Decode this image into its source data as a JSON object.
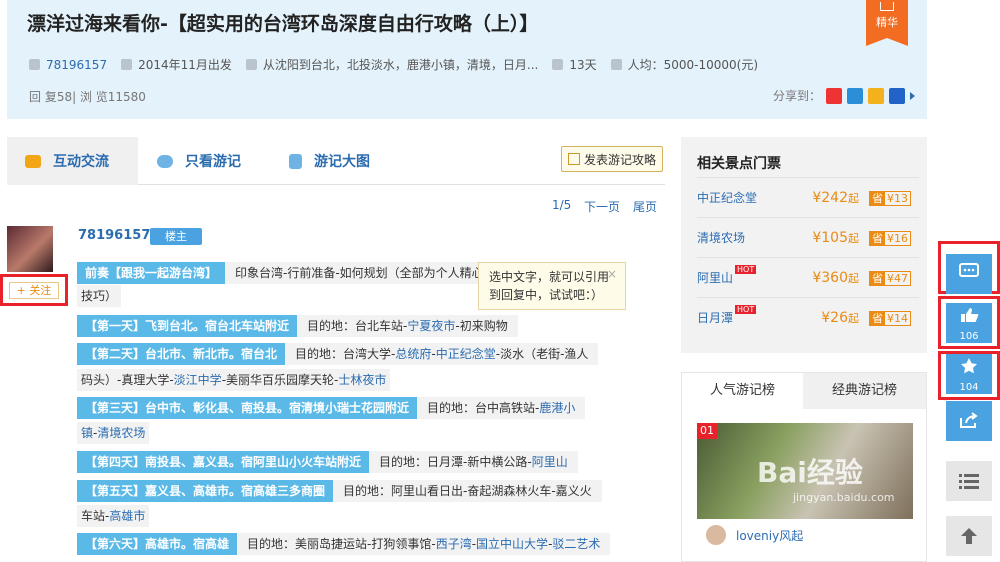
{
  "header": {
    "title": "漂洋过海来看你-【超实用的台湾环岛深度自由行攻略（上）】",
    "badge": "精华",
    "author": "78196157",
    "depart": "2014年11月出发",
    "route": "从沈阳到台北，北投淡水，鹿港小镇，清境，日月...",
    "days": "13天",
    "budget": "人均：5000-10000(元)",
    "stats": "回 复58| 浏 览11580",
    "share_label": "分享到："
  },
  "tabs": [
    {
      "label": "互动交流"
    },
    {
      "label": "只看游记"
    },
    {
      "label": "游记大图"
    }
  ],
  "post_button": "发表游记攻略",
  "pager": {
    "page": "1/5",
    "next": "下一页",
    "last": "尾页"
  },
  "post": {
    "follow": "+ 关注",
    "username": "78196157",
    "role": "楼主"
  },
  "tip": {
    "text": "选中文字，就可以引用到回复中，试试吧：）",
    "close": "×"
  },
  "toc": [
    {
      "tag": "前奏【跟我一起游台湾】",
      "desc": "印象台湾-行前准备-如何规划（全部为个人精心",
      "cont": "技巧）"
    },
    {
      "tag": "【第一天】飞到台北。宿台北车站附近",
      "desc": "目的地：台北车站-",
      "link": "宁夏夜市",
      "after": "-初来购物"
    },
    {
      "tag": "【第二天】台北市、新北市。宿台北",
      "desc": "目的地：台湾大学-",
      "link": "总统府",
      "mid": "-",
      "link2": "中正纪念堂",
      "after": "-淡水（老街-渔人",
      "cont_pre": "码头）-真理大学-",
      "cont_link": "淡江中学",
      "cont_mid": "-美丽华百乐园摩天轮-",
      "cont_link2": "士林夜市"
    },
    {
      "tag": "【第三天】台中市、彰化县、南投县。宿清境小瑞士花园附近",
      "desc": "目的地：台中高铁站-",
      "link": "鹿港小",
      "cont_link": "镇",
      "cont_mid": "-",
      "cont_link2": "清境农场"
    },
    {
      "tag": "【第四天】南投县、嘉义县。宿阿里山小火车站附近",
      "desc": "目的地：日月潭-新中横公路-",
      "link": "阿里山"
    },
    {
      "tag": "【第五天】嘉义县、高雄市。宿高雄三多商圈",
      "desc": "目的地：阿里山看日出-奋起湖森林火车-嘉义火",
      "cont_pre": "车站-",
      "cont_link": "高雄市"
    },
    {
      "tag": "【第六天】高雄市。宿高雄",
      "desc": "目的地：美丽岛捷运站-打狗领事馆-",
      "link": "西子湾",
      "mid": "-",
      "link2": "国立中山大学",
      "after": "-",
      "link3": "驳二艺术"
    }
  ],
  "tickets": {
    "title": "相关景点门票",
    "items": [
      {
        "name": "中正纪念堂",
        "price": "¥242",
        "unit": "起",
        "save": "省",
        "discount": "¥13",
        "hot": ""
      },
      {
        "name": "清境农场",
        "price": "¥105",
        "unit": "起",
        "save": "省",
        "discount": "¥16",
        "hot": ""
      },
      {
        "name": "阿里山",
        "price": "¥360",
        "unit": "起",
        "save": "省",
        "discount": "¥47",
        "hot": "HOT"
      },
      {
        "name": "日月潭",
        "price": "¥26",
        "unit": "起",
        "save": "省",
        "discount": "¥14",
        "hot": "HOT"
      }
    ]
  },
  "ranking": {
    "tabs": [
      "人气游记榜",
      "经典游记榜"
    ],
    "rank_no": "01",
    "watermark": "Bai经验",
    "watermark_url": "jingyan.baidu.com",
    "user": "loveniy风起"
  },
  "float": {
    "like_count": "106",
    "fav_count": "104"
  },
  "colors": {
    "accent": "#4aa3e0",
    "highlight": "#e8212b",
    "price": "#e98b14"
  }
}
